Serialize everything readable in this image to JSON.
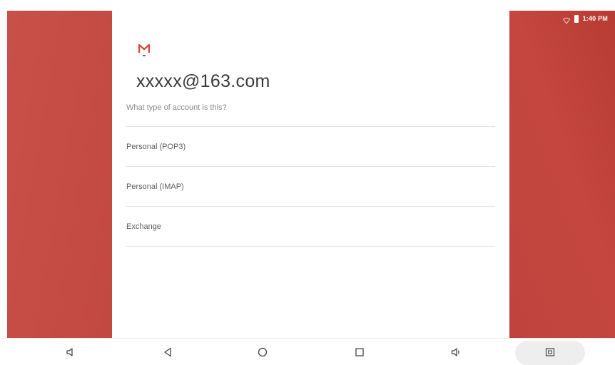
{
  "status_bar": {
    "time": "1:40 PM",
    "icons": [
      "wifi-icon",
      "battery-icon"
    ]
  },
  "app": {
    "logo_icon": "gmail-logo-icon",
    "brand_color": "#c9463f"
  },
  "account": {
    "email": "xxxxx@163.com",
    "question": "What type of account is this?",
    "options": [
      {
        "label": "Personal (POP3)"
      },
      {
        "label": "Personal (IMAP)"
      },
      {
        "label": "Exchange"
      }
    ]
  },
  "navigation_bar": {
    "buttons": [
      {
        "icon": "volume-down-icon"
      },
      {
        "icon": "back-icon"
      },
      {
        "icon": "home-icon"
      },
      {
        "icon": "recents-icon"
      },
      {
        "icon": "volume-up-icon"
      },
      {
        "icon": "screenshot-icon"
      }
    ]
  }
}
